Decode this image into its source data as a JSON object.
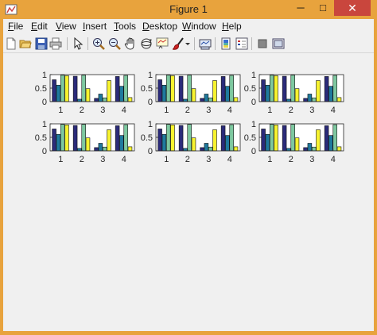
{
  "window": {
    "title": "Figure 1",
    "minimize_glyph": "─",
    "maximize_glyph": "□",
    "close_glyph": "✕"
  },
  "menu": {
    "items": [
      {
        "label": "File",
        "underline": "F",
        "rest": "ile"
      },
      {
        "label": "Edit",
        "underline": "E",
        "rest": "dit"
      },
      {
        "label": "View",
        "underline": "V",
        "rest": "iew"
      },
      {
        "label": "Insert",
        "underline": "I",
        "rest": "nsert"
      },
      {
        "label": "Tools",
        "underline": "T",
        "rest": "ools"
      },
      {
        "label": "Desktop",
        "underline": "D",
        "rest": "esktop"
      },
      {
        "label": "Window",
        "underline": "W",
        "rest": "indow"
      },
      {
        "label": "Help",
        "underline": "H",
        "rest": "elp"
      }
    ]
  },
  "toolbar": {
    "icons": [
      "new-figure-icon",
      "open-file-icon",
      "save-icon",
      "print-icon",
      "edit-plot-icon",
      "zoom-in-icon",
      "zoom-out-icon",
      "pan-icon",
      "rotate-3d-icon",
      "data-cursor-icon",
      "brush-icon",
      "brush-dropdown-icon",
      "link-plot-icon",
      "insert-colorbar-icon",
      "insert-legend-icon",
      "hide-plot-tools-icon",
      "show-plot-tools-icon"
    ]
  },
  "colors": {
    "title_bar": "#e8a33d",
    "close_button": "#c9463d",
    "series": [
      "#2b2b7a",
      "#1f7a9e",
      "#7ec8a0",
      "#f7f32f"
    ]
  },
  "chart_data": [
    {
      "type": "bar",
      "categories": [
        "1",
        "2",
        "3",
        "4"
      ],
      "series": [
        {
          "values": [
            0.81,
            0.94,
            0.12,
            0.93
          ]
        },
        {
          "values": [
            0.61,
            0.09,
            0.28,
            0.57
          ]
        },
        {
          "values": [
            0.98,
            0.98,
            0.14,
            0.97
          ]
        },
        {
          "values": [
            0.96,
            0.48,
            0.78,
            0.15
          ]
        }
      ],
      "ylim": [
        0,
        1
      ],
      "yticks": [
        "0",
        "0.5",
        "1"
      ]
    },
    {
      "type": "bar",
      "categories": [
        "1",
        "2",
        "3",
        "4"
      ],
      "series": [
        {
          "values": [
            0.81,
            0.94,
            0.12,
            0.93
          ]
        },
        {
          "values": [
            0.61,
            0.09,
            0.28,
            0.57
          ]
        },
        {
          "values": [
            0.98,
            0.98,
            0.14,
            0.97
          ]
        },
        {
          "values": [
            0.96,
            0.48,
            0.78,
            0.15
          ]
        }
      ],
      "ylim": [
        0,
        1
      ],
      "yticks": [
        "0",
        "0.5",
        "1"
      ]
    },
    {
      "type": "bar",
      "categories": [
        "1",
        "2",
        "3",
        "4"
      ],
      "series": [
        {
          "values": [
            0.81,
            0.94,
            0.12,
            0.93
          ]
        },
        {
          "values": [
            0.61,
            0.09,
            0.28,
            0.57
          ]
        },
        {
          "values": [
            0.98,
            0.98,
            0.14,
            0.97
          ]
        },
        {
          "values": [
            0.96,
            0.48,
            0.78,
            0.15
          ]
        }
      ],
      "ylim": [
        0,
        1
      ],
      "yticks": [
        "0",
        "0.5",
        "1"
      ]
    },
    {
      "type": "bar",
      "categories": [
        "1",
        "2",
        "3",
        "4"
      ],
      "series": [
        {
          "values": [
            0.81,
            0.94,
            0.12,
            0.93
          ]
        },
        {
          "values": [
            0.61,
            0.09,
            0.28,
            0.57
          ]
        },
        {
          "values": [
            0.98,
            0.98,
            0.14,
            0.97
          ]
        },
        {
          "values": [
            0.96,
            0.48,
            0.78,
            0.15
          ]
        }
      ],
      "ylim": [
        0,
        1
      ],
      "yticks": [
        "0",
        "0.5",
        "1"
      ]
    },
    {
      "type": "bar",
      "categories": [
        "1",
        "2",
        "3",
        "4"
      ],
      "series": [
        {
          "values": [
            0.81,
            0.94,
            0.12,
            0.93
          ]
        },
        {
          "values": [
            0.61,
            0.09,
            0.28,
            0.57
          ]
        },
        {
          "values": [
            0.98,
            0.98,
            0.14,
            0.97
          ]
        },
        {
          "values": [
            0.96,
            0.48,
            0.78,
            0.15
          ]
        }
      ],
      "ylim": [
        0,
        1
      ],
      "yticks": [
        "0",
        "0.5",
        "1"
      ]
    },
    {
      "type": "bar",
      "categories": [
        "1",
        "2",
        "3",
        "4"
      ],
      "series": [
        {
          "values": [
            0.81,
            0.94,
            0.12,
            0.93
          ]
        },
        {
          "values": [
            0.61,
            0.09,
            0.28,
            0.57
          ]
        },
        {
          "values": [
            0.98,
            0.98,
            0.14,
            0.97
          ]
        },
        {
          "values": [
            0.96,
            0.48,
            0.78,
            0.15
          ]
        }
      ],
      "ylim": [
        0,
        1
      ],
      "yticks": [
        "0",
        "0.5",
        "1"
      ]
    }
  ]
}
